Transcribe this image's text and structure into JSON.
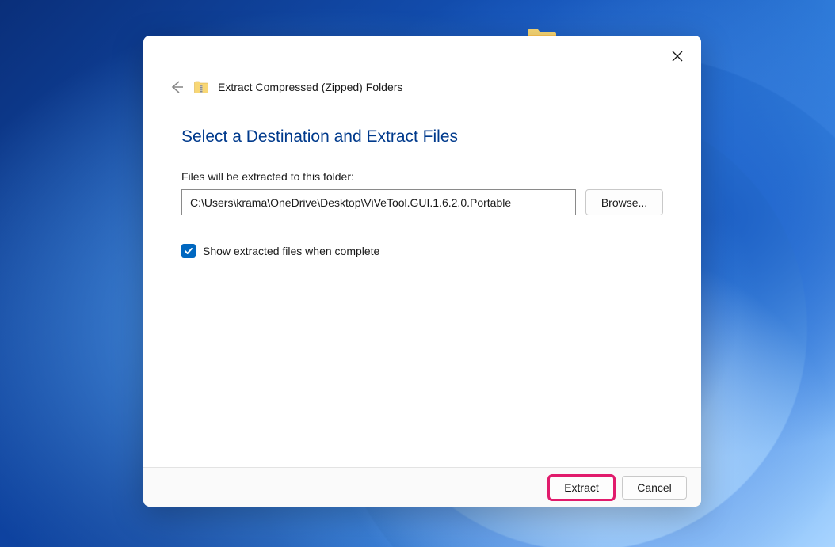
{
  "dialog": {
    "title": "Extract Compressed (Zipped) Folders",
    "heading": "Select a Destination and Extract Files",
    "destination": {
      "label": "Files will be extracted to this folder:",
      "value": "C:\\Users\\krama\\OneDrive\\Desktop\\ViVeTool.GUI.1.6.2.0.Portable",
      "browse_label": "Browse..."
    },
    "show_files_checkbox": {
      "checked": true,
      "label": "Show extracted files when complete"
    },
    "footer": {
      "extract_label": "Extract",
      "cancel_label": "Cancel"
    }
  }
}
